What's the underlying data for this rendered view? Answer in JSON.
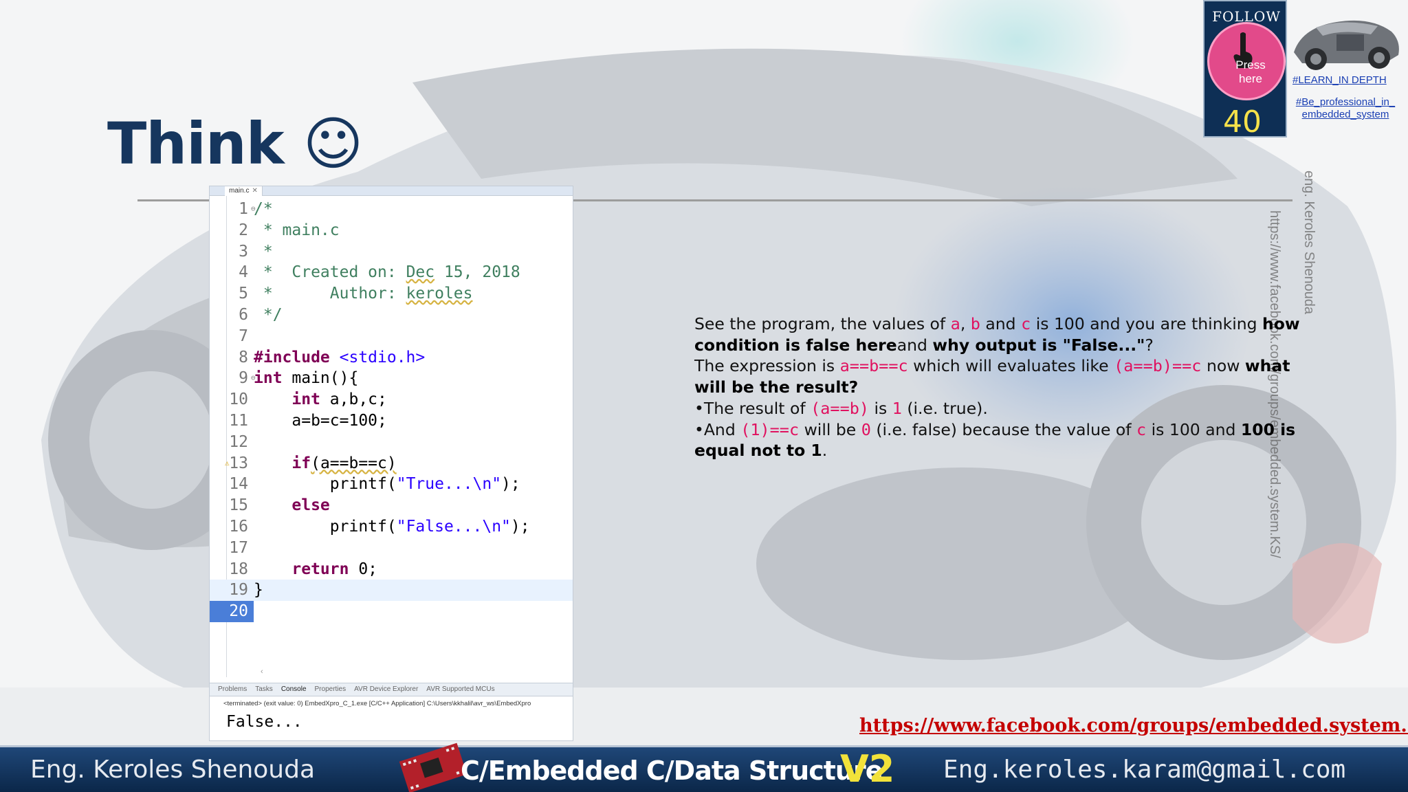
{
  "slide": {
    "title": "Think ☺"
  },
  "badge": {
    "follow_label": "FOLLOW US",
    "press_label": "Press here",
    "number": "40",
    "learn_link": "#LEARN_IN DEPTH",
    "be_link": "#Be_professional_in_ embedded_system"
  },
  "watermarks": {
    "author": "eng. Keroles Shenouda",
    "url": "https://www.facebook.com/groups/embedded.system.KS/"
  },
  "ide": {
    "tab_label": "main.c",
    "code_lines": [
      {
        "n": "1",
        "parts": [
          {
            "c": "cm",
            "t": "/*"
          }
        ]
      },
      {
        "n": "2",
        "parts": [
          {
            "c": "cm",
            "t": " * main.c"
          }
        ]
      },
      {
        "n": "3",
        "parts": [
          {
            "c": "cm",
            "t": " *"
          }
        ]
      },
      {
        "n": "4",
        "parts": [
          {
            "c": "cm",
            "t": " *  Created on: "
          },
          {
            "c": "cm und",
            "t": "Dec"
          },
          {
            "c": "cm",
            "t": " 15, 2018"
          }
        ]
      },
      {
        "n": "5",
        "parts": [
          {
            "c": "cm",
            "t": " *      Author: "
          },
          {
            "c": "cm und",
            "t": "keroles"
          }
        ]
      },
      {
        "n": "6",
        "parts": [
          {
            "c": "cm",
            "t": " */"
          }
        ]
      },
      {
        "n": "7",
        "parts": []
      },
      {
        "n": "8",
        "parts": [
          {
            "c": "kw",
            "t": "#include"
          },
          {
            "c": "st",
            "t": " <stdio.h>"
          }
        ]
      },
      {
        "n": "9",
        "parts": [
          {
            "c": "kw",
            "t": "int"
          },
          {
            "c": "txt",
            "t": " main(){"
          }
        ]
      },
      {
        "n": "10",
        "parts": [
          {
            "c": "txt",
            "t": "    "
          },
          {
            "c": "kw",
            "t": "int"
          },
          {
            "c": "txt",
            "t": " a,b,c;"
          }
        ]
      },
      {
        "n": "11",
        "parts": [
          {
            "c": "txt",
            "t": "    a=b=c=100;"
          }
        ]
      },
      {
        "n": "12",
        "parts": []
      },
      {
        "n": "13",
        "parts": [
          {
            "c": "txt",
            "t": "    "
          },
          {
            "c": "kw",
            "t": "if"
          },
          {
            "c": "txt und",
            "t": "(a==b==c)"
          }
        ]
      },
      {
        "n": "14",
        "parts": [
          {
            "c": "txt",
            "t": "        printf("
          },
          {
            "c": "st",
            "t": "\"True...\\n\""
          },
          {
            "c": "txt",
            "t": ");"
          }
        ]
      },
      {
        "n": "15",
        "parts": [
          {
            "c": "txt",
            "t": "    "
          },
          {
            "c": "kw",
            "t": "else"
          }
        ]
      },
      {
        "n": "16",
        "parts": [
          {
            "c": "txt",
            "t": "        printf("
          },
          {
            "c": "st",
            "t": "\"False...\\n\""
          },
          {
            "c": "txt",
            "t": ");"
          }
        ]
      },
      {
        "n": "17",
        "parts": []
      },
      {
        "n": "18",
        "parts": [
          {
            "c": "txt",
            "t": "    "
          },
          {
            "c": "kw",
            "t": "return"
          },
          {
            "c": "txt",
            "t": " 0;"
          }
        ]
      },
      {
        "n": "19",
        "parts": [
          {
            "c": "txt",
            "t": "}"
          }
        ]
      },
      {
        "n": "20",
        "parts": []
      }
    ],
    "console_tabs": [
      "Problems",
      "Tasks",
      "Console",
      "Properties",
      "AVR Device Explorer",
      "AVR Supported MCUs"
    ],
    "console_status": "<terminated> (exit value: 0) EmbedXpro_C_1.exe [C/C++ Application] C:\\Users\\kkhalil\\avr_ws\\EmbedXpro",
    "console_output": "False..."
  },
  "explanation": {
    "p1_a": "See the program, the values of ",
    "var_a": "a",
    "comma": ", ",
    "var_b": "b",
    "and": " and ",
    "var_c": "c",
    "p1_b": " is 100 and you are thinking ",
    "p1_bold1": "how condition is false here",
    "p1_c": "and ",
    "p1_bold2": "why output is \"False...\"",
    "p1_d": "?",
    "p2_a": "The expression is ",
    "p2_code1": "a==b==c",
    "p2_b": " which will evaluates like ",
    "p2_code2": "(a==b)==c",
    "p2_c": " now ",
    "p2_bold": "what will be the result?",
    "p3_a": "•The result of ",
    "p3_code1": "(a==b)",
    "p3_b": " is ",
    "p3_code2": "1",
    "p3_c": " (i.e. true).",
    "p4_a": "•And ",
    "p4_code1": "(1)==c",
    "p4_b": " will be ",
    "p4_code2": "0",
    "p4_c": " (i.e. false) because the value of ",
    "p4_code3": "c",
    "p4_d": " is 100 and ",
    "p4_bold": "100 is equal not to 1",
    "p4_e": "."
  },
  "bottom_link": "https://www.facebook.com/groups/embedded.system.KS/",
  "footer": {
    "left": "Eng. Keroles Shenouda",
    "middle": "C/Embedded C/Data Structure",
    "version": "V2",
    "right": "Eng.keroles.karam@gmail.com"
  },
  "colors": {
    "title": "#16365e",
    "footer_bg": "#0b2749",
    "code_highlight": "#e0115f",
    "link_red": "#c40000",
    "version_yellow": "#f2e23a"
  }
}
